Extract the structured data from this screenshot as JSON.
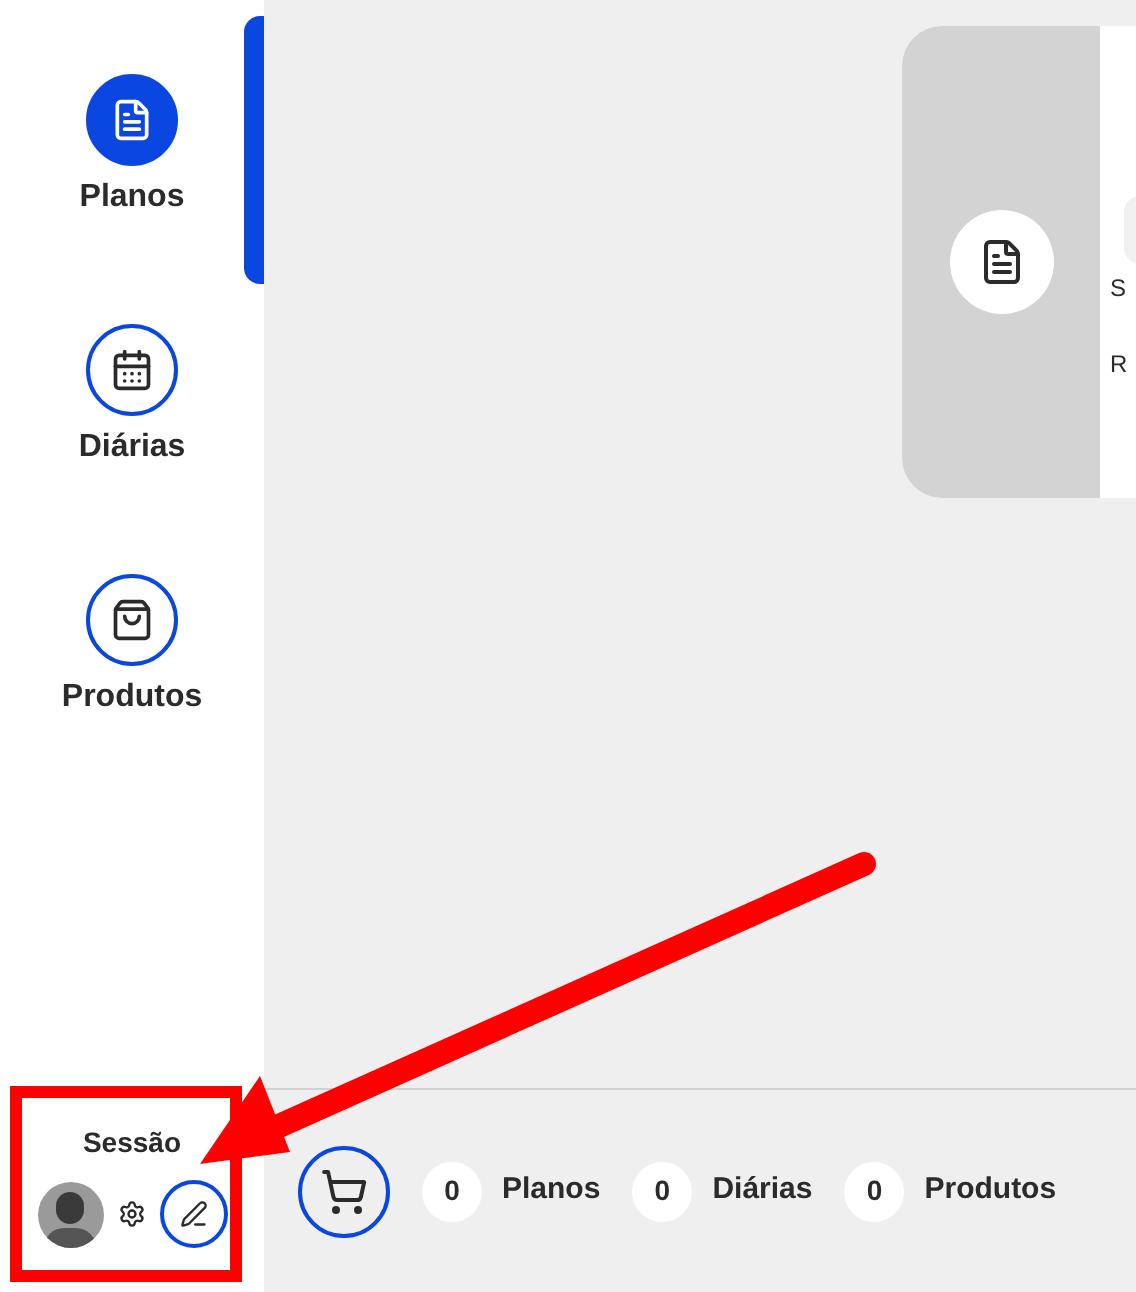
{
  "sidebar": {
    "items": [
      {
        "label": "Planos",
        "selected": true
      },
      {
        "label": "Diárias",
        "selected": false
      },
      {
        "label": "Produtos",
        "selected": false
      }
    ],
    "session": {
      "label": "Sessão"
    }
  },
  "card": {
    "lines": [
      "S",
      "R"
    ]
  },
  "cart": {
    "counters": [
      {
        "count": "0",
        "label": "Planos"
      },
      {
        "count": "0",
        "label": "Diárias"
      },
      {
        "count": "0",
        "label": "Produtos"
      }
    ]
  }
}
